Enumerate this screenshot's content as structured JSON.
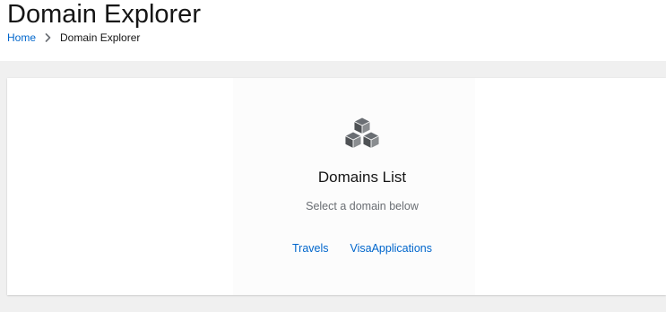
{
  "header": {
    "title": "Domain Explorer",
    "breadcrumb": {
      "home_label": "Home",
      "current_label": "Domain Explorer"
    }
  },
  "empty_state": {
    "icon": "cubes-icon",
    "title": "Domains List",
    "body": "Select a domain below"
  },
  "domains": [
    "Travels",
    "VisaApplications"
  ],
  "colors": {
    "link": "#0066cc",
    "title_text": "#151515",
    "secondary_text": "#6a6e73",
    "page_background": "#f0f0f0",
    "card_background": "#ffffff",
    "icon": "#6a6e73"
  }
}
